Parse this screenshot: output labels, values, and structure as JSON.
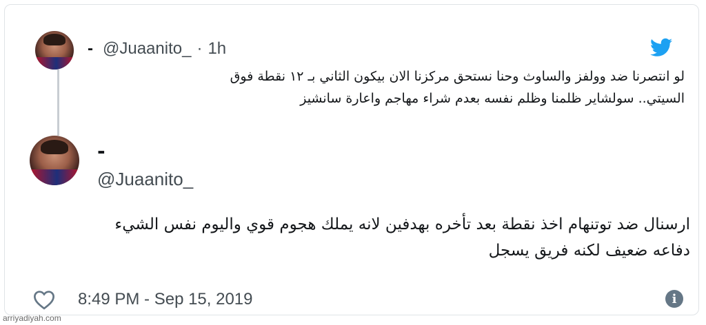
{
  "quoted_tweet": {
    "display_name": "-",
    "handle": "@Juaanito_",
    "separator": "·",
    "time_ago": "1h",
    "text_lines": [
      "لو انتصرنا ضد وولفز والساوث وحنا نستحق مركزنا الان بيكون الثاني بـ ١٢ نقطة فوق",
      "السيتي.. سولشاير ظلمنا وظلم نفسه بعدم شراء مهاجم واعارة سانشيز"
    ]
  },
  "main_tweet": {
    "display_name": "-",
    "handle": "@Juaanito_",
    "text_lines": [
      "ارسنال ضد توتنهام اخذ نقطة بعد تأخره بهدفين لانه يملك هجوم قوي واليوم نفس الشيء",
      "دفاعه ضعيف لكنه فريق يسجل"
    ],
    "timestamp": "8:49 PM - Sep 15, 2019"
  },
  "icons": {
    "brand": "twitter-icon",
    "like": "heart-icon",
    "info": "info-icon"
  },
  "colors": {
    "twitter_blue": "#1da1f2",
    "text_primary": "#14171a",
    "text_secondary": "#444c52",
    "thread_line": "#c8cdd2",
    "info_gray": "#657786"
  },
  "watermark": "arriyadiyah.com"
}
